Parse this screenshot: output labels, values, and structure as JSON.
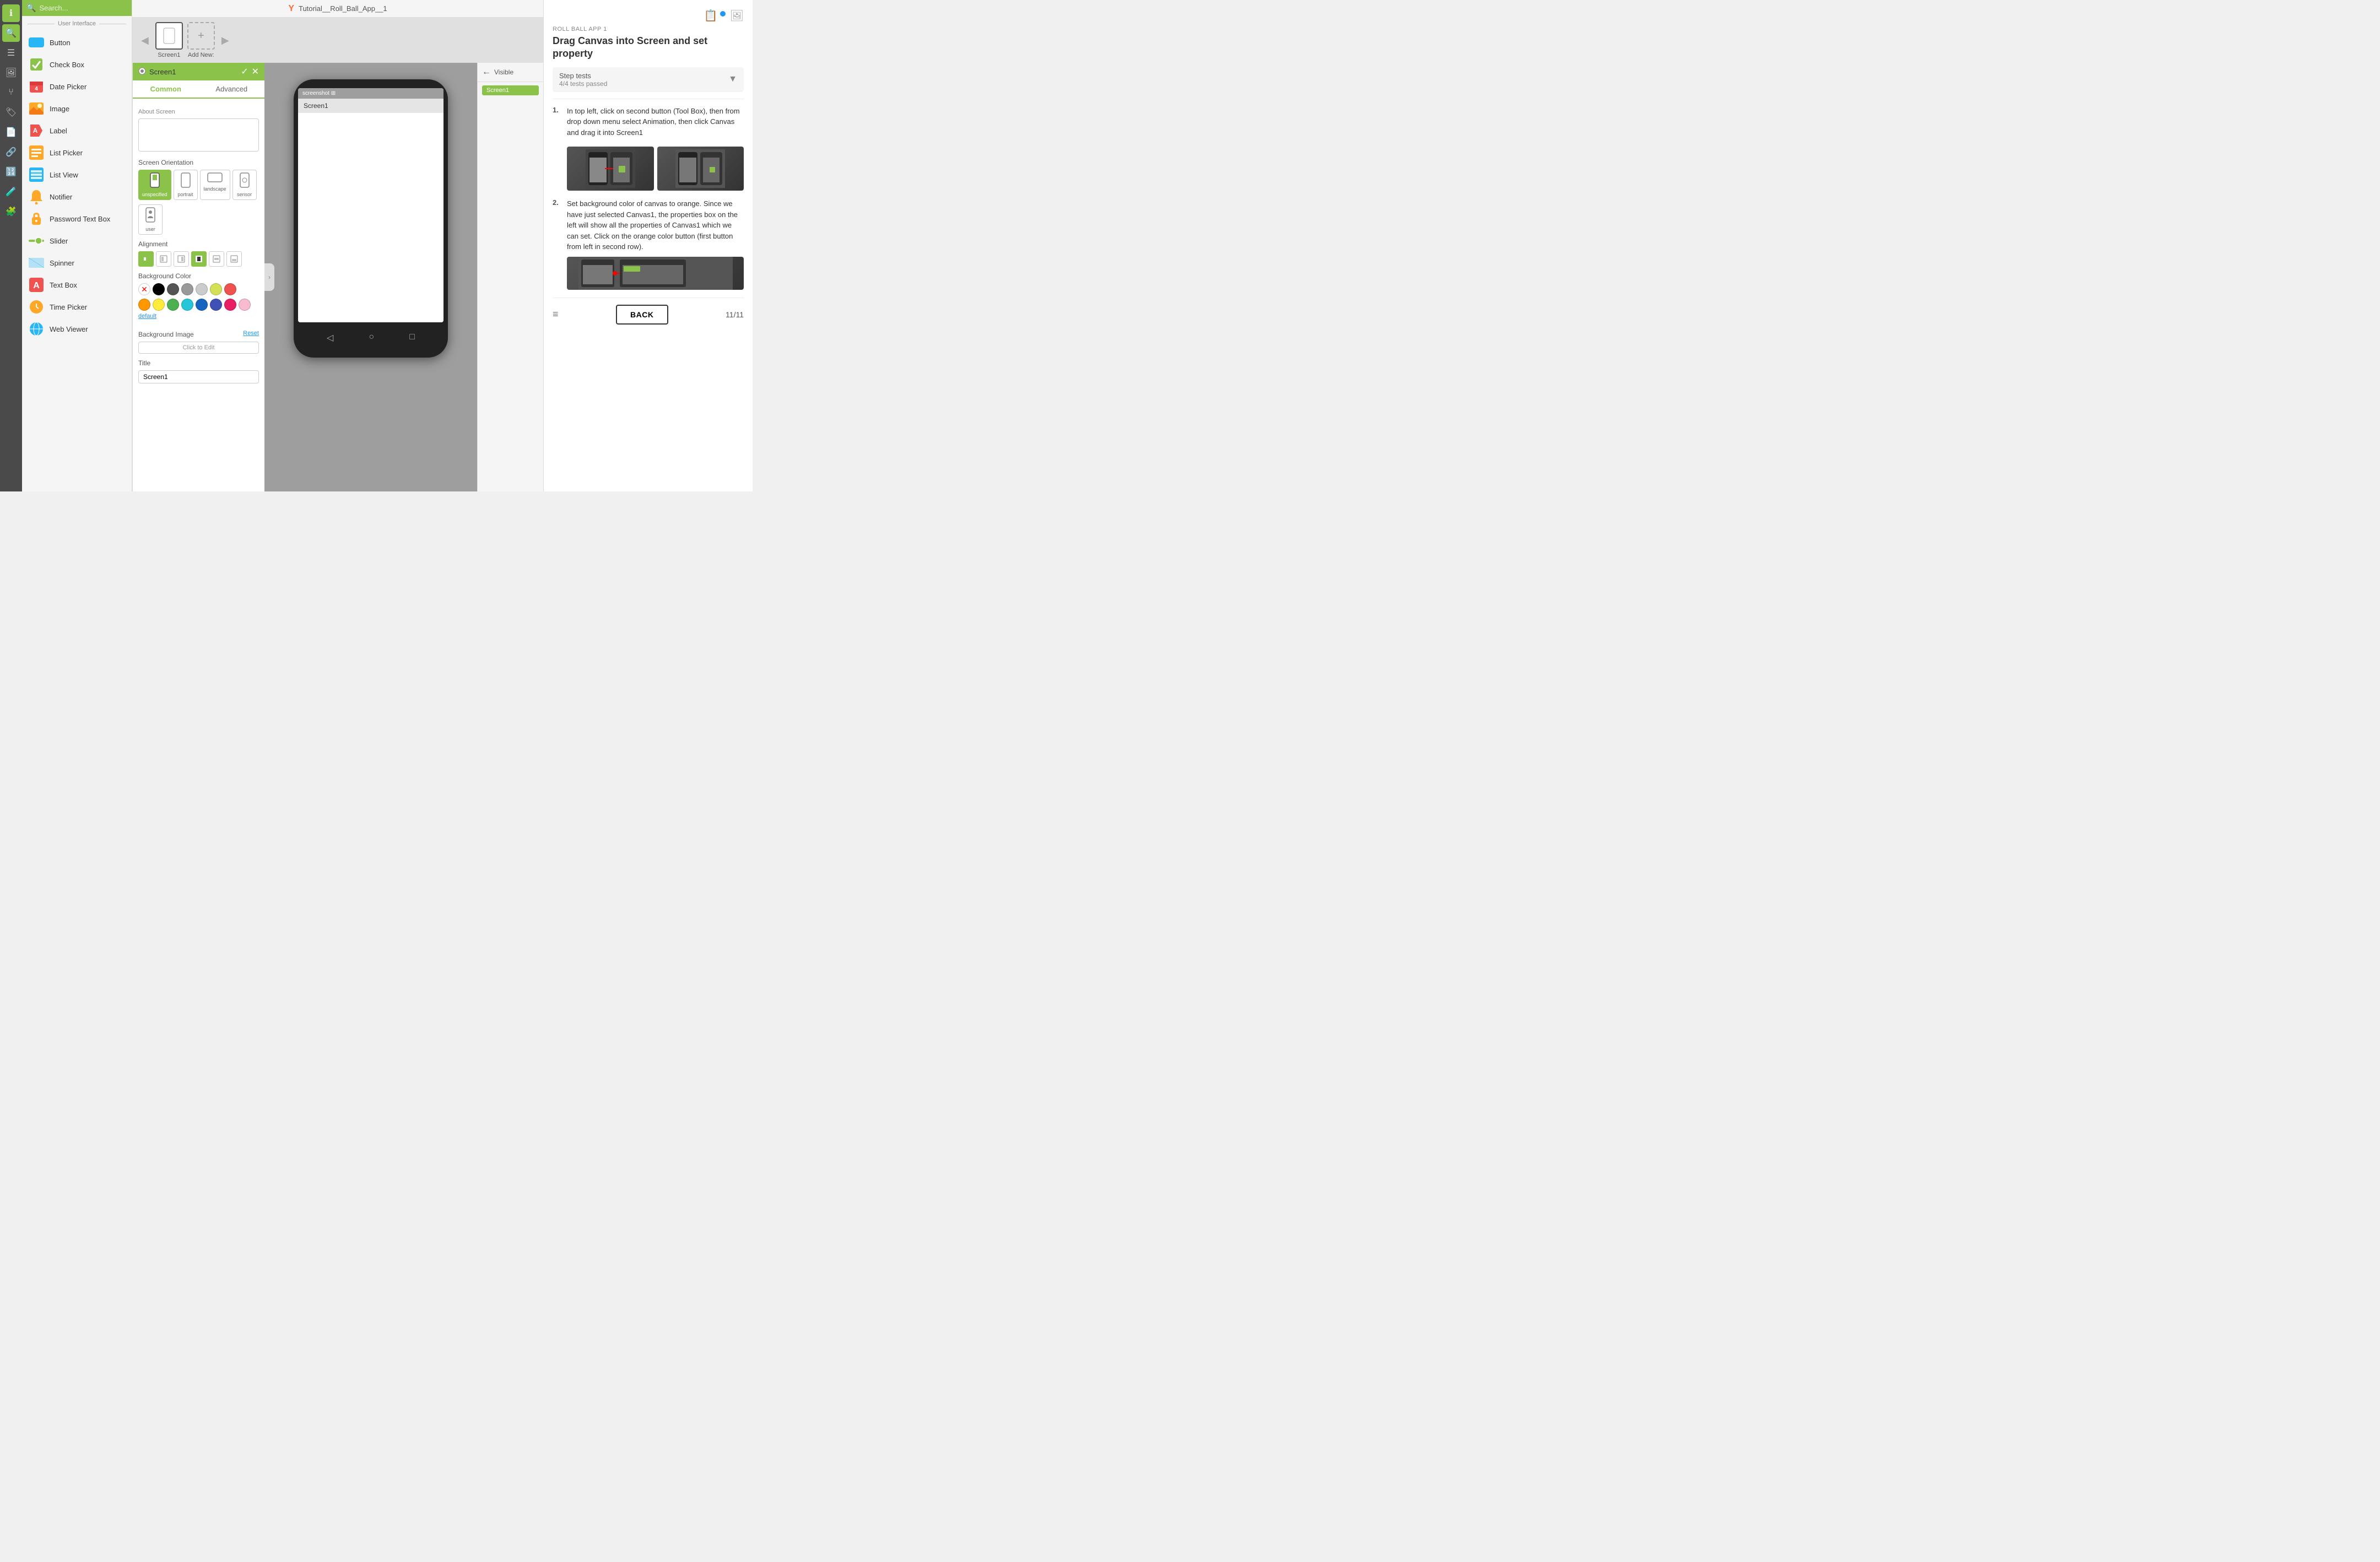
{
  "app": {
    "title": "Tutorial__Roll_Ball_App__1",
    "logo": "Y"
  },
  "search": {
    "placeholder": "Search..."
  },
  "left_sidebar": {
    "icons": [
      {
        "name": "info-icon",
        "symbol": "ℹ",
        "active": false
      },
      {
        "name": "search-icon",
        "symbol": "🔍",
        "active": true
      },
      {
        "name": "list-icon",
        "symbol": "☰",
        "active": false
      },
      {
        "name": "image-icon",
        "symbol": "🖼",
        "active": false
      },
      {
        "name": "share-icon",
        "symbol": "⑂",
        "active": false
      },
      {
        "name": "tag-icon",
        "symbol": "🏷",
        "active": false
      },
      {
        "name": "doc-icon",
        "symbol": "📄",
        "active": false
      },
      {
        "name": "link-icon",
        "symbol": "🔗",
        "active": false
      },
      {
        "name": "num-icon",
        "symbol": "🔢",
        "active": false
      },
      {
        "name": "flask-icon",
        "symbol": "🧪",
        "active": false
      },
      {
        "name": "puzzle-icon",
        "symbol": "🧩",
        "active": false
      }
    ]
  },
  "component_panel": {
    "section": "User Interface",
    "components": [
      {
        "name": "Button",
        "icon": "⬜",
        "color": "#29b6f6"
      },
      {
        "name": "Check Box",
        "icon": "✅",
        "color": "#8bc34a"
      },
      {
        "name": "Date Picker",
        "icon": "📅",
        "color": "#ef5350"
      },
      {
        "name": "Image",
        "icon": "🖼",
        "color": "#ffa726"
      },
      {
        "name": "Label",
        "icon": "🏷",
        "color": "#ef5350"
      },
      {
        "name": "List Picker",
        "icon": "📋",
        "color": "#ffa726"
      },
      {
        "name": "List View",
        "icon": "☰",
        "color": "#29b6f6"
      },
      {
        "name": "Notifier",
        "icon": "🔔",
        "color": "#ffa726"
      },
      {
        "name": "Password Text Box",
        "icon": "🔒",
        "color": "#ffa726"
      },
      {
        "name": "Slider",
        "icon": "⊟",
        "color": "#8bc34a"
      },
      {
        "name": "Spinner",
        "icon": "⊙",
        "color": "#29b6f6"
      },
      {
        "name": "Text Box",
        "icon": "A",
        "color": "#ef5350"
      },
      {
        "name": "Time Picker",
        "icon": "⏱",
        "color": "#ffa726"
      },
      {
        "name": "Web Viewer",
        "icon": "🌍",
        "color": "#29b6f6"
      }
    ]
  },
  "screen_tabs": {
    "screens": [
      {
        "label": "Screen1",
        "active": true
      }
    ],
    "add_label": "Add New:",
    "nav_prev": "◀",
    "nav_next": "▶"
  },
  "phone": {
    "screen_label": "Screen1",
    "status_bar": "screenshot    ⊞"
  },
  "properties_panel": {
    "screen_name": "Screen1",
    "tabs": {
      "common": "Common",
      "advanced": "Advanced"
    },
    "active_tab": "Common",
    "about_screen_label": "About Screen",
    "about_screen_value": "",
    "screen_orientation_label": "Screen Orientation",
    "orientations": [
      {
        "id": "unspecified",
        "label": "unspecified",
        "active": true
      },
      {
        "id": "portrait",
        "label": "portrait",
        "active": false
      },
      {
        "id": "landscape",
        "label": "landscape",
        "active": false
      },
      {
        "id": "sensor",
        "label": "sensor",
        "active": false
      },
      {
        "id": "user",
        "label": "user",
        "active": false
      }
    ],
    "alignment_label": "Alignment",
    "alignments_row1": [
      "⊞",
      "⊟",
      "⊠"
    ],
    "alignments_row2": [
      "⊞",
      "⊟",
      "⊠"
    ],
    "background_color_label": "Background Color",
    "colors": [
      {
        "hex": "none",
        "label": "none"
      },
      {
        "hex": "#000000",
        "label": "black"
      },
      {
        "hex": "#555555",
        "label": "dark gray"
      },
      {
        "hex": "#999999",
        "label": "gray"
      },
      {
        "hex": "#cccccc",
        "label": "light gray"
      },
      {
        "hex": "#d4e157",
        "label": "lime"
      },
      {
        "hex": "#ef5350",
        "label": "red"
      },
      {
        "hex": "#ff9800",
        "label": "orange"
      },
      {
        "hex": "#ffeb3b",
        "label": "yellow"
      },
      {
        "hex": "#4caf50",
        "label": "green"
      },
      {
        "hex": "#26c6da",
        "label": "teal"
      },
      {
        "hex": "#1565c0",
        "label": "dark blue"
      },
      {
        "hex": "#3f51b5",
        "label": "indigo"
      },
      {
        "hex": "#e91e63",
        "label": "pink"
      },
      {
        "hex": "#f8bbd0",
        "label": "light pink"
      }
    ],
    "default_link": "default",
    "background_image_label": "Background Image",
    "background_image_placeholder": "Click to Edit",
    "reset_link": "Reset",
    "title_label": "Title",
    "title_value": "Screen1"
  },
  "visible_panel": {
    "label": "Visible",
    "screen_name": "Screen1"
  },
  "tutorial": {
    "app_name": "ROLL BALL APP 1",
    "title": "Drag Canvas into Screen and set property",
    "step_tests_label": "Step tests",
    "tests_passed": "4/4 tests passed",
    "steps": [
      {
        "num": "1.",
        "text": "In top left, click on second button (Tool Box), then from drop down menu select Animation, then click Canvas and drag it into Screen1"
      },
      {
        "num": "2.",
        "text": "Set background color of canvas to orange. Since we have just selected Canvas1, the properties box on the left will show all the properties of Canvas1 which we can set. Click on the orange color button (first button from left in second row)."
      }
    ],
    "back_label": "BACK",
    "page_count": "11/11"
  }
}
